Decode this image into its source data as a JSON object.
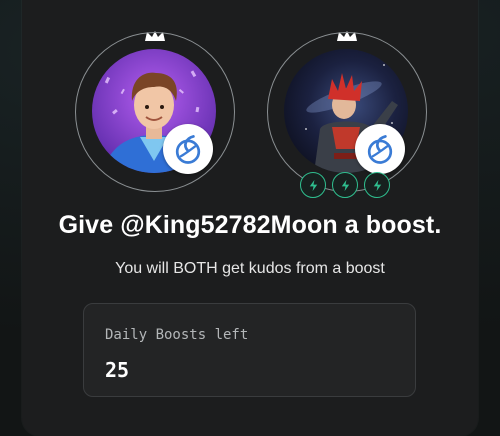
{
  "colors": {
    "background": "#121515",
    "card": "#1c1d1e",
    "accent_blue": "#3a7bd5",
    "bolt_green": "#2fbf8f",
    "ring": "#8a8f92"
  },
  "users": {
    "left": {
      "avatar_desc_icon": "user-avatar-icon",
      "crown_icon": "crown-icon",
      "badge_icon": "app-logo-icon"
    },
    "right": {
      "avatar_desc_icon": "user-avatar-icon",
      "crown_icon": "crown-icon",
      "badge_icon": "app-logo-icon",
      "bolt_count": 3,
      "bolt_icon": "lightning-bolt-icon"
    }
  },
  "boost": {
    "title": "Give @King52782Moon a boost.",
    "subtitle": "You will BOTH get kudos from a boost",
    "daily_label": "Daily Boosts left",
    "daily_value": "25"
  }
}
